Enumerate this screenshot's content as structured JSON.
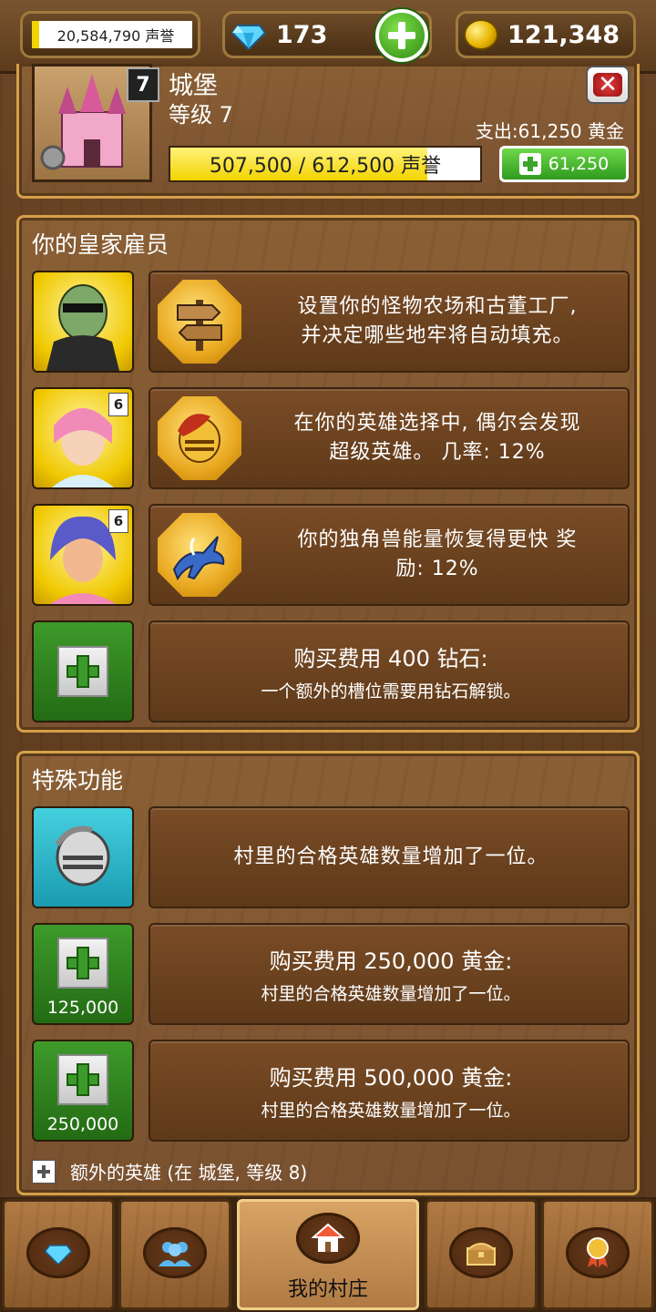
{
  "header": {
    "reputation": "20,584,790 声誉",
    "gems": "173",
    "gold": "121,348"
  },
  "castle": {
    "level_badge": "7",
    "name": "城堡",
    "level": "等级 7",
    "expense": "支出:61,250 黄金",
    "progress_text": "507,500 / 612,500 声誉",
    "progress_fraction": 0.8286,
    "upgrade_price": "61,250"
  },
  "staff": {
    "title": "你的皇家雇员",
    "rows": [
      {
        "rank": "",
        "text": "设置你的怪物农场和古董工厂,\n并决定哪些地牢将自动填充。",
        "icon": "signpost-icon"
      },
      {
        "rank": "6",
        "text": "在你的英雄选择中, 偶尔会发现\n超级英雄。 几率: 12%",
        "icon": "knight-helmet-icon"
      },
      {
        "rank": "6",
        "text": "你的独角兽能量恢复得更快 奖\n励: 12%",
        "icon": "unicorn-icon"
      }
    ],
    "buy_slot": {
      "main": "购买费用 400 钻石:",
      "sub": "一个额外的槽位需要用钻石解锁。"
    }
  },
  "special": {
    "title": "特殊功能",
    "owned": "村里的合格英雄数量增加了一位。",
    "buy1": {
      "price": "125,000",
      "main": "购买费用 250,000 黄金:",
      "sub": "村里的合格英雄数量增加了一位。"
    },
    "buy2": {
      "price": "250,000",
      "main": "购买费用 500,000 黄金:",
      "sub": "村里的合格英雄数量增加了一位。"
    },
    "extra": "额外的英雄 (在 城堡, 等级 8)"
  },
  "nav": {
    "active_label": "我的村庄",
    "items": [
      "gem-shop-icon",
      "heroes-icon",
      "village-home-icon",
      "treasure-chest-icon",
      "medal-icon"
    ]
  },
  "colors": {
    "accent_gold": "#d4a04a",
    "button_green": "#2f9a1e",
    "progress_yellow": "#f2d400"
  }
}
